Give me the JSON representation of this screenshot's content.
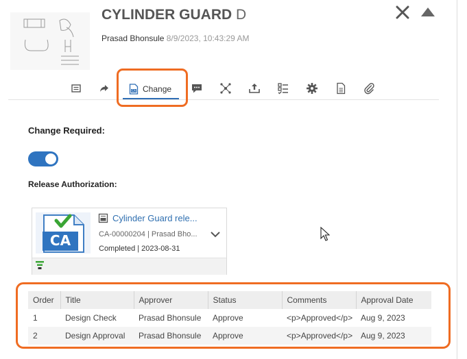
{
  "header": {
    "title": "CYLINDER GUARD",
    "revision": "D",
    "author": "Prasad Bhonsule",
    "timestamp": "8/9/2023, 10:43:29 AM"
  },
  "toolbar": {
    "active_tab_label": "Change",
    "icons": [
      "form-icon",
      "share-arrow-icon",
      "change-icon",
      "comment-icon",
      "network-icon",
      "upload-icon",
      "checklist-icon",
      "gear-icon",
      "document-icon",
      "paperclip-icon"
    ]
  },
  "change": {
    "required_label": "Change Required:",
    "required_on": true,
    "release_label": "Release Authorization:"
  },
  "release_card": {
    "title": "Cylinder Guard rele...",
    "number": "CA-00000204 | Prasad Bho...",
    "status": "Completed | 2023-08-31",
    "badge": "CA"
  },
  "approvals": {
    "columns": [
      "Order",
      "Title",
      "Approver",
      "Status",
      "Comments",
      "Approval Date"
    ],
    "rows": [
      {
        "order": "1",
        "title": "Design Check",
        "approver": "Prasad Bhonsule",
        "status": "Approve",
        "comments": "<p>Approved</p>",
        "date": "Aug 9, 2023"
      },
      {
        "order": "2",
        "title": "Design Approval",
        "approver": "Prasad Bhonsule",
        "status": "Approve",
        "comments": "<p>Approved</p>",
        "date": "Aug 9, 2023"
      }
    ]
  },
  "colors": {
    "accent": "#2e6db4",
    "highlight": "#ef6c22",
    "toggle": "#2f74c0"
  }
}
